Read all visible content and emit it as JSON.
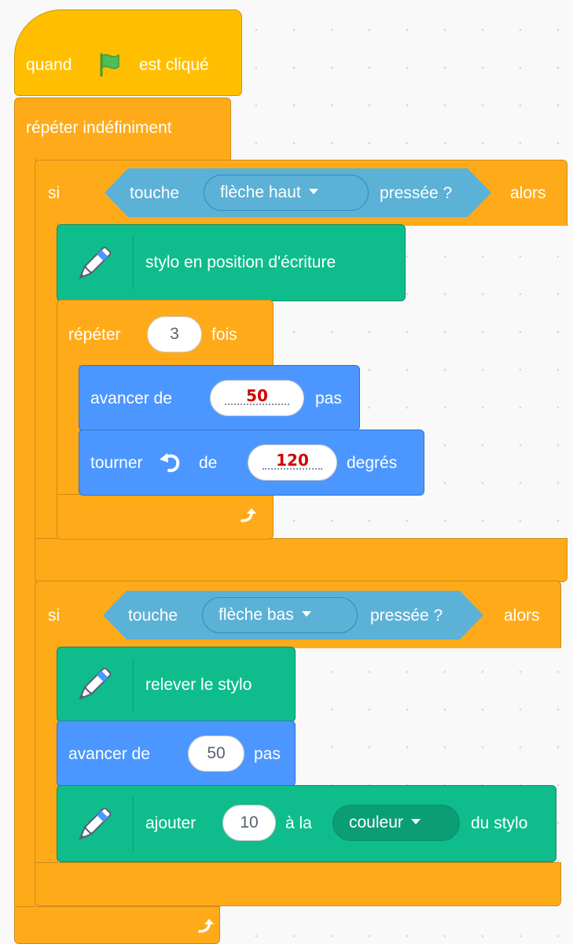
{
  "hat": {
    "when": "quand",
    "clicked": "est cliqué"
  },
  "forever": {
    "label": "répéter indéfiniment"
  },
  "if1": {
    "si": "si",
    "key_label": "touche",
    "key_value": "flèche haut",
    "pressed": "pressée ?",
    "then": "alors",
    "pen_down": "stylo en position d'écriture",
    "repeat": {
      "label": "répéter",
      "count": "3",
      "times": "fois"
    },
    "move": {
      "label": "avancer de",
      "value": "50",
      "unit": "pas"
    },
    "turn": {
      "label": "tourner",
      "of": "de",
      "value": "120",
      "unit": "degrés"
    }
  },
  "if2": {
    "si": "si",
    "key_label": "touche",
    "key_value": "flèche bas",
    "pressed": "pressée ?",
    "then": "alors",
    "pen_up": "relever le stylo",
    "move": {
      "label": "avancer de",
      "value": "50",
      "unit": "pas"
    },
    "change": {
      "label": "ajouter",
      "value": "10",
      "to": "à la",
      "param": "couleur",
      "suffix": "du stylo"
    }
  },
  "colors": {
    "control": "#ffab19",
    "events": "#ffbf00",
    "pen": "#0fbd8c",
    "motion": "#4c97ff",
    "sensing": "#5cb1d6",
    "highlight": "#d40000"
  }
}
